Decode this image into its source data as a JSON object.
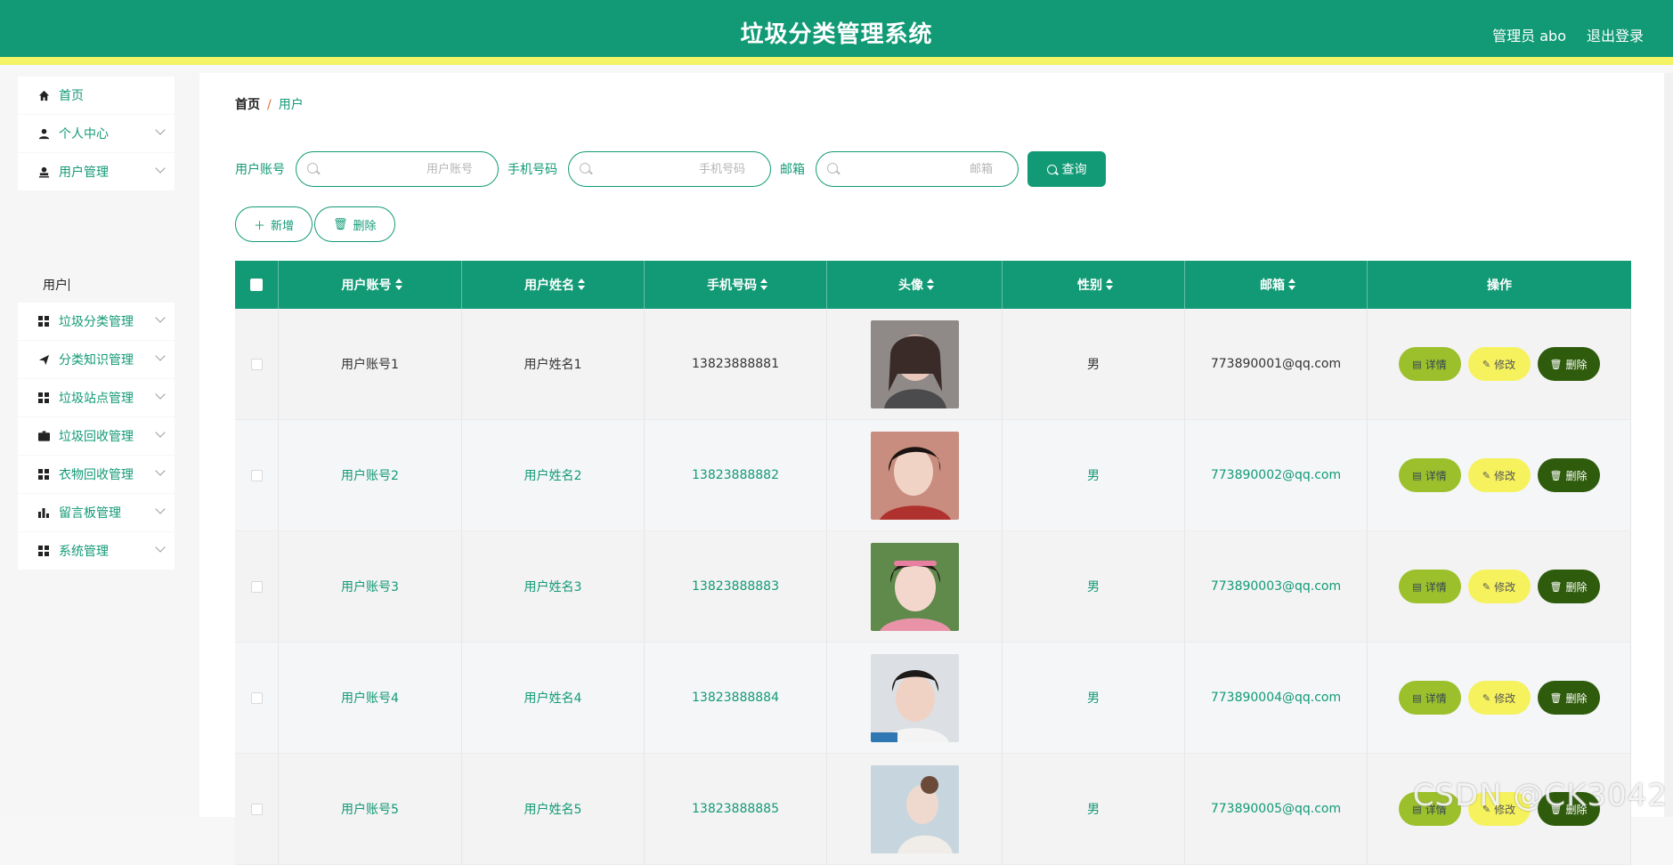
{
  "header": {
    "title": "垃圾分类管理系统",
    "admin": "管理员 abo",
    "logout": "退出登录"
  },
  "colors": {
    "primary": "#129a76",
    "accent_yellow": "#f2f466",
    "detail_btn": "#9cc02c",
    "edit_btn": "#f5f25d",
    "delete_btn": "#2f5c0c"
  },
  "sidebar": {
    "items": [
      {
        "label": "首页",
        "icon": "home-icon"
      },
      {
        "label": "个人中心",
        "icon": "person-icon"
      },
      {
        "label": "用户管理",
        "icon": "user-stamp-icon"
      },
      {
        "label": "垃圾分类管理",
        "icon": "grid-icon"
      },
      {
        "label": "分类知识管理",
        "icon": "paper-plane-icon"
      },
      {
        "label": "垃圾站点管理",
        "icon": "grid-icon"
      },
      {
        "label": "垃圾回收管理",
        "icon": "briefcase-icon"
      },
      {
        "label": "衣物回收管理",
        "icon": "grid-icon"
      },
      {
        "label": "留言板管理",
        "icon": "bar-chart-icon"
      },
      {
        "label": "系统管理",
        "icon": "grid-icon"
      }
    ],
    "submenu_active": "用户"
  },
  "breadcrumb": {
    "home": "首页",
    "sep": "/",
    "current": "用户"
  },
  "search": {
    "account_label": "用户账号",
    "account_placeholder": "用户账号",
    "phone_label": "手机号码",
    "phone_placeholder": "手机号码",
    "email_label": "邮箱",
    "email_placeholder": "邮箱",
    "query": "查询"
  },
  "actions": {
    "add": "新增",
    "delete": "删除"
  },
  "table": {
    "headers": [
      "用户账号",
      "用户姓名",
      "手机号码",
      "头像",
      "性别",
      "邮箱",
      "操作"
    ],
    "rows": [
      {
        "account": "用户账号1",
        "name": "用户姓名1",
        "phone": "13823888881",
        "gender": "男",
        "email": "773890001@qq.com"
      },
      {
        "account": "用户账号2",
        "name": "用户姓名2",
        "phone": "13823888882",
        "gender": "男",
        "email": "773890002@qq.com"
      },
      {
        "account": "用户账号3",
        "name": "用户姓名3",
        "phone": "13823888883",
        "gender": "男",
        "email": "773890003@qq.com"
      },
      {
        "account": "用户账号4",
        "name": "用户姓名4",
        "phone": "13823888884",
        "gender": "男",
        "email": "773890004@qq.com"
      },
      {
        "account": "用户账号5",
        "name": "用户姓名5",
        "phone": "13823888885",
        "gender": "男",
        "email": "773890005@qq.com"
      }
    ],
    "buttons": {
      "detail": "详情",
      "edit": "修改",
      "delete": "删除"
    }
  },
  "watermark": "CSDN @CK3042"
}
